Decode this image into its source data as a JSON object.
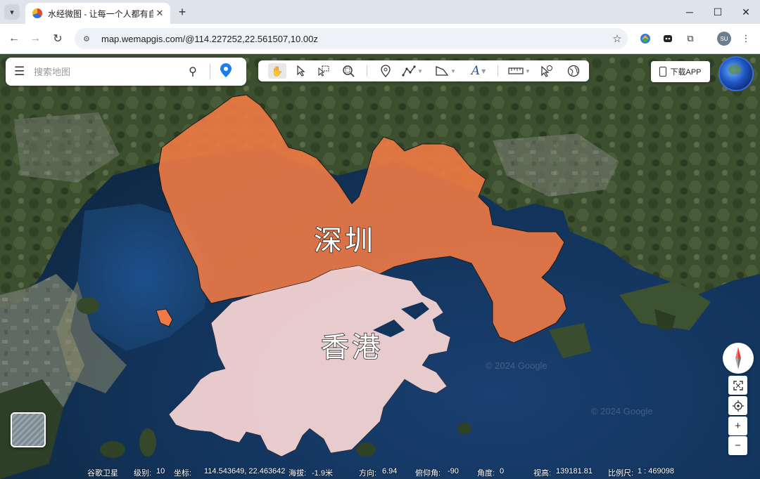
{
  "browser": {
    "tab_title": "水经微图 - 让每一个人都有自己",
    "url": "map.wemapgis.com/@114.227252,22.561507,10.00z"
  },
  "search": {
    "placeholder": "搜索地图"
  },
  "toolbar": {
    "tools": [
      "pan-hand",
      "select-arrow",
      "select-area",
      "zoom-search",
      "marker",
      "polyline",
      "polygon",
      "text",
      "measure",
      "pick",
      "globe-view"
    ]
  },
  "download_label": "下载APP",
  "map": {
    "labels": {
      "shenzhen": "深圳",
      "hongkong": "香港"
    },
    "watermarks": [
      "© 2024 Google",
      "© 2024 Google"
    ],
    "colors": {
      "shenzhen_fill": "#f07a45",
      "hongkong_fill": "#f3d3d3"
    }
  },
  "status": {
    "source": "谷歌卫星",
    "level_label": "级别:",
    "level": "10",
    "coord_label": "坐标:",
    "coord": "114.543649, 22.463642",
    "altitude_label": "海拔:",
    "altitude": "-1.9米",
    "direction_label": "方向:",
    "direction": "6.94",
    "pitch_label": "俯仰角:",
    "pitch": "-90",
    "angle_label": "角度:",
    "angle": "0",
    "view_height_label": "视高:",
    "view_height": "139181.81",
    "scale_label": "比例尺:",
    "scale": "1 : 469098"
  }
}
